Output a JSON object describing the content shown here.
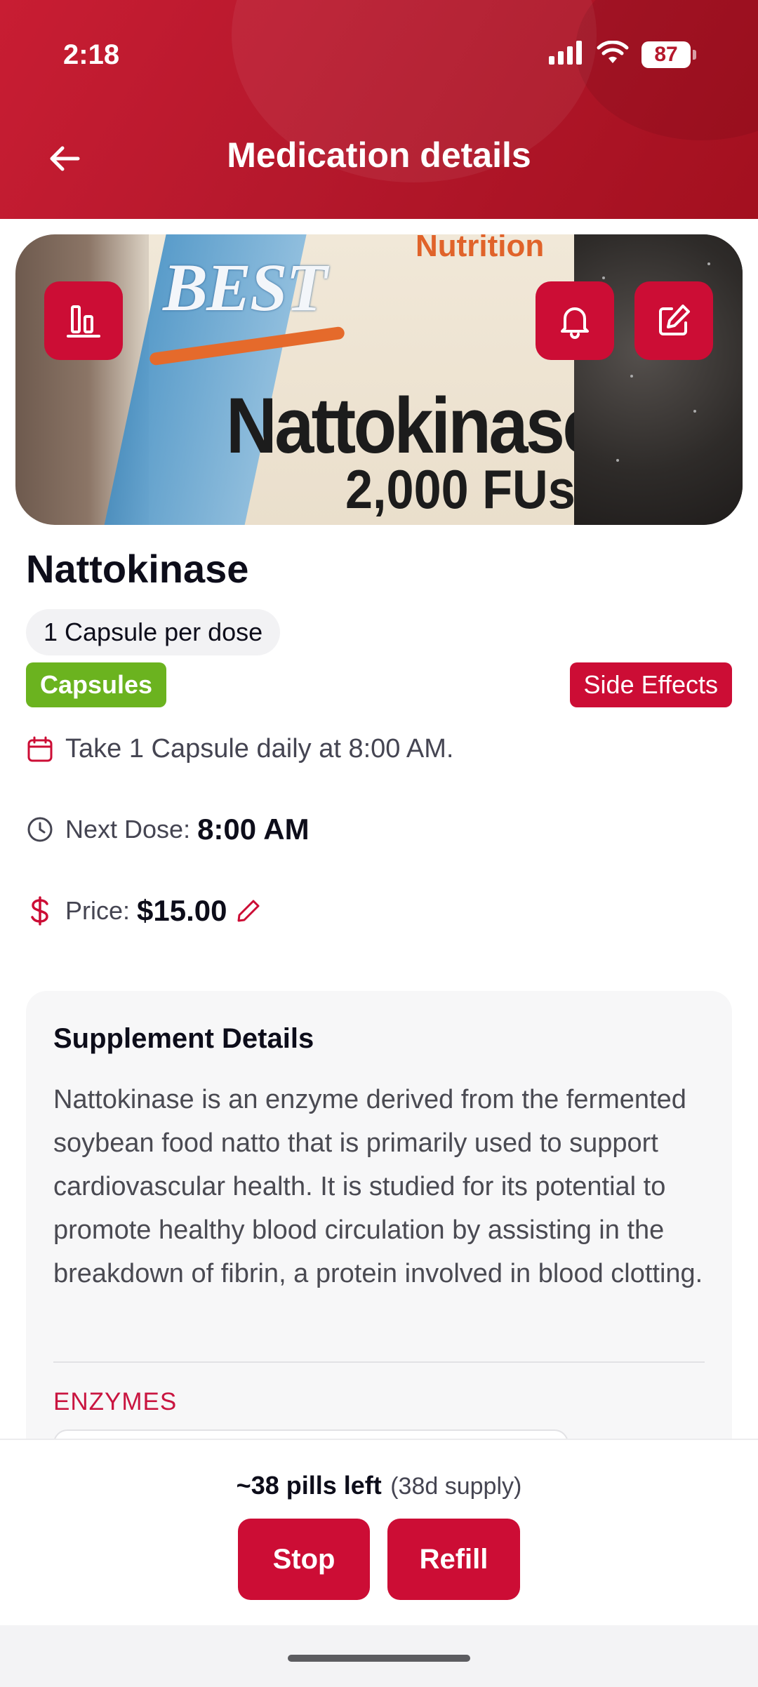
{
  "status_bar": {
    "time": "2:18",
    "battery": "87"
  },
  "header": {
    "title": "Medication details"
  },
  "hero": {
    "photo_text": {
      "brand": "BEST",
      "top": "Nutrition",
      "product": "Nattokinase",
      "strength": "2,000 FUs"
    },
    "icons": [
      "chart-icon",
      "bell-icon",
      "edit-icon"
    ]
  },
  "medication": {
    "name": "Nattokinase",
    "dose": "1 Capsule per dose",
    "type": "Capsules",
    "side_effects_label": "Side Effects",
    "schedule": "Take 1 Capsule daily at 8:00 AM.",
    "next_dose_label": "Next Dose:",
    "next_dose_value": "8:00 AM",
    "price_label": "Price:",
    "price_value": "$15.00"
  },
  "details": {
    "title": "Supplement Details",
    "body": "Nattokinase is an enzyme derived from the fermented soybean food natto that is primarily used to support cardiovascular health. It is studied for its potential to promote healthy blood circulation by assisting in the breakdown of fibrin, a protein involved in blood clotting.",
    "category": "ENZYMES"
  },
  "supply": {
    "pills": "~38 pills left",
    "days": "(38d supply)"
  },
  "actions": {
    "stop": "Stop",
    "refill": "Refill"
  },
  "colors": {
    "primary": "#cc0d35",
    "header": "#b5182c",
    "capsule_badge": "#6bb31f"
  }
}
